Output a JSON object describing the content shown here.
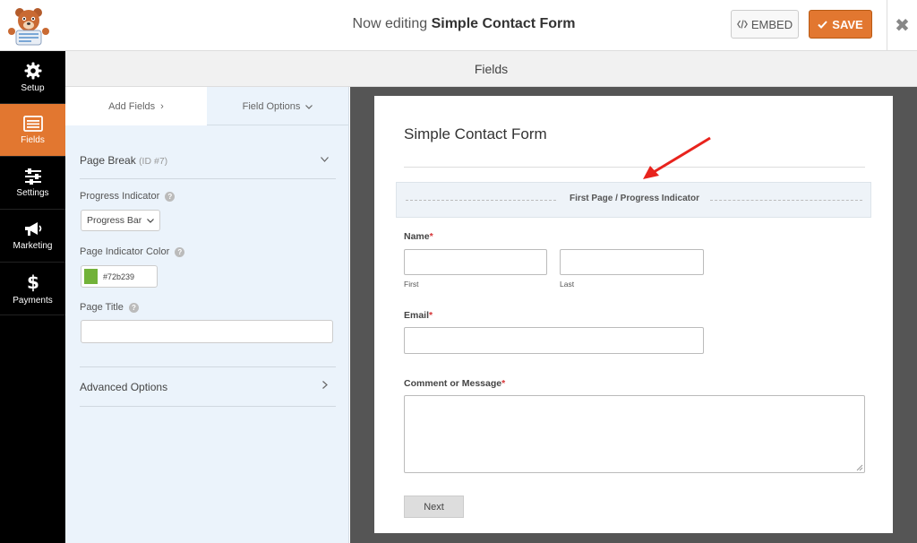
{
  "header": {
    "editing_prefix": "Now editing",
    "form_name": "Simple Contact Form",
    "embed_label": "EMBED",
    "save_label": "SAVE",
    "close_symbol": "✖"
  },
  "sidebar": {
    "items": [
      {
        "label": "Setup",
        "icon": "gear-icon"
      },
      {
        "label": "Fields",
        "icon": "fields-icon"
      },
      {
        "label": "Settings",
        "icon": "sliders-icon"
      },
      {
        "label": "Marketing",
        "icon": "megaphone-icon"
      },
      {
        "label": "Payments",
        "icon": "dollar-icon"
      }
    ],
    "active_index": 1
  },
  "section_header": "Fields",
  "panel": {
    "tabs": [
      {
        "label": "Add Fields",
        "chevron": "›"
      },
      {
        "label": "Field Options",
        "chevron": "⌄"
      }
    ],
    "field_title": "Page Break",
    "field_id": "(ID #7)",
    "progress_indicator_label": "Progress Indicator",
    "progress_indicator_value": "Progress Bar",
    "indicator_color_label": "Page Indicator Color",
    "indicator_color_value": "#72b239",
    "page_title_label": "Page Title",
    "page_title_value": "",
    "advanced_label": "Advanced Options"
  },
  "preview": {
    "form_title": "Simple Contact Form",
    "page_break_label": "First Page / Progress Indicator",
    "fields": {
      "name_label": "Name",
      "first_sub": "First",
      "last_sub": "Last",
      "email_label": "Email",
      "comment_label": "Comment or Message",
      "required_mark": "*"
    },
    "next_label": "Next"
  },
  "colors": {
    "accent": "#e27730",
    "nav_bg": "#000000",
    "panel_bg": "#ebf3fb",
    "preview_bg": "#555555",
    "arrow": "#e8231d"
  }
}
